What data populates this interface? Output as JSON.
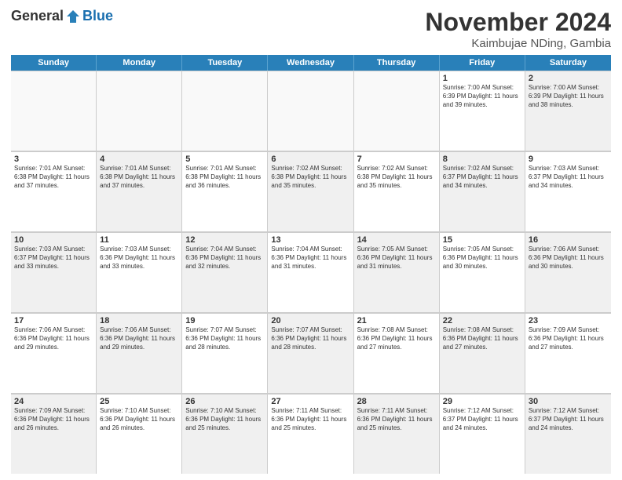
{
  "header": {
    "logo_general": "General",
    "logo_blue": "Blue",
    "month": "November 2024",
    "location": "Kaimbujae NDing, Gambia"
  },
  "weekdays": [
    "Sunday",
    "Monday",
    "Tuesday",
    "Wednesday",
    "Thursday",
    "Friday",
    "Saturday"
  ],
  "rows": [
    [
      {
        "day": "",
        "info": "",
        "empty": true
      },
      {
        "day": "",
        "info": "",
        "empty": true
      },
      {
        "day": "",
        "info": "",
        "empty": true
      },
      {
        "day": "",
        "info": "",
        "empty": true
      },
      {
        "day": "",
        "info": "",
        "empty": true
      },
      {
        "day": "1",
        "info": "Sunrise: 7:00 AM\nSunset: 6:39 PM\nDaylight: 11 hours and 39 minutes.",
        "empty": false
      },
      {
        "day": "2",
        "info": "Sunrise: 7:00 AM\nSunset: 6:39 PM\nDaylight: 11 hours and 38 minutes.",
        "empty": false,
        "shaded": true
      }
    ],
    [
      {
        "day": "3",
        "info": "Sunrise: 7:01 AM\nSunset: 6:38 PM\nDaylight: 11 hours and 37 minutes.",
        "empty": false
      },
      {
        "day": "4",
        "info": "Sunrise: 7:01 AM\nSunset: 6:38 PM\nDaylight: 11 hours and 37 minutes.",
        "empty": false,
        "shaded": true
      },
      {
        "day": "5",
        "info": "Sunrise: 7:01 AM\nSunset: 6:38 PM\nDaylight: 11 hours and 36 minutes.",
        "empty": false
      },
      {
        "day": "6",
        "info": "Sunrise: 7:02 AM\nSunset: 6:38 PM\nDaylight: 11 hours and 35 minutes.",
        "empty": false,
        "shaded": true
      },
      {
        "day": "7",
        "info": "Sunrise: 7:02 AM\nSunset: 6:38 PM\nDaylight: 11 hours and 35 minutes.",
        "empty": false
      },
      {
        "day": "8",
        "info": "Sunrise: 7:02 AM\nSunset: 6:37 PM\nDaylight: 11 hours and 34 minutes.",
        "empty": false,
        "shaded": true
      },
      {
        "day": "9",
        "info": "Sunrise: 7:03 AM\nSunset: 6:37 PM\nDaylight: 11 hours and 34 minutes.",
        "empty": false
      }
    ],
    [
      {
        "day": "10",
        "info": "Sunrise: 7:03 AM\nSunset: 6:37 PM\nDaylight: 11 hours and 33 minutes.",
        "empty": false,
        "shaded": true
      },
      {
        "day": "11",
        "info": "Sunrise: 7:03 AM\nSunset: 6:36 PM\nDaylight: 11 hours and 33 minutes.",
        "empty": false
      },
      {
        "day": "12",
        "info": "Sunrise: 7:04 AM\nSunset: 6:36 PM\nDaylight: 11 hours and 32 minutes.",
        "empty": false,
        "shaded": true
      },
      {
        "day": "13",
        "info": "Sunrise: 7:04 AM\nSunset: 6:36 PM\nDaylight: 11 hours and 31 minutes.",
        "empty": false
      },
      {
        "day": "14",
        "info": "Sunrise: 7:05 AM\nSunset: 6:36 PM\nDaylight: 11 hours and 31 minutes.",
        "empty": false,
        "shaded": true
      },
      {
        "day": "15",
        "info": "Sunrise: 7:05 AM\nSunset: 6:36 PM\nDaylight: 11 hours and 30 minutes.",
        "empty": false
      },
      {
        "day": "16",
        "info": "Sunrise: 7:06 AM\nSunset: 6:36 PM\nDaylight: 11 hours and 30 minutes.",
        "empty": false,
        "shaded": true
      }
    ],
    [
      {
        "day": "17",
        "info": "Sunrise: 7:06 AM\nSunset: 6:36 PM\nDaylight: 11 hours and 29 minutes.",
        "empty": false
      },
      {
        "day": "18",
        "info": "Sunrise: 7:06 AM\nSunset: 6:36 PM\nDaylight: 11 hours and 29 minutes.",
        "empty": false,
        "shaded": true
      },
      {
        "day": "19",
        "info": "Sunrise: 7:07 AM\nSunset: 6:36 PM\nDaylight: 11 hours and 28 minutes.",
        "empty": false
      },
      {
        "day": "20",
        "info": "Sunrise: 7:07 AM\nSunset: 6:36 PM\nDaylight: 11 hours and 28 minutes.",
        "empty": false,
        "shaded": true
      },
      {
        "day": "21",
        "info": "Sunrise: 7:08 AM\nSunset: 6:36 PM\nDaylight: 11 hours and 27 minutes.",
        "empty": false
      },
      {
        "day": "22",
        "info": "Sunrise: 7:08 AM\nSunset: 6:36 PM\nDaylight: 11 hours and 27 minutes.",
        "empty": false,
        "shaded": true
      },
      {
        "day": "23",
        "info": "Sunrise: 7:09 AM\nSunset: 6:36 PM\nDaylight: 11 hours and 27 minutes.",
        "empty": false
      }
    ],
    [
      {
        "day": "24",
        "info": "Sunrise: 7:09 AM\nSunset: 6:36 PM\nDaylight: 11 hours and 26 minutes.",
        "empty": false,
        "shaded": true
      },
      {
        "day": "25",
        "info": "Sunrise: 7:10 AM\nSunset: 6:36 PM\nDaylight: 11 hours and 26 minutes.",
        "empty": false
      },
      {
        "day": "26",
        "info": "Sunrise: 7:10 AM\nSunset: 6:36 PM\nDaylight: 11 hours and 25 minutes.",
        "empty": false,
        "shaded": true
      },
      {
        "day": "27",
        "info": "Sunrise: 7:11 AM\nSunset: 6:36 PM\nDaylight: 11 hours and 25 minutes.",
        "empty": false
      },
      {
        "day": "28",
        "info": "Sunrise: 7:11 AM\nSunset: 6:36 PM\nDaylight: 11 hours and 25 minutes.",
        "empty": false,
        "shaded": true
      },
      {
        "day": "29",
        "info": "Sunrise: 7:12 AM\nSunset: 6:37 PM\nDaylight: 11 hours and 24 minutes.",
        "empty": false
      },
      {
        "day": "30",
        "info": "Sunrise: 7:12 AM\nSunset: 6:37 PM\nDaylight: 11 hours and 24 minutes.",
        "empty": false,
        "shaded": true
      }
    ]
  ]
}
